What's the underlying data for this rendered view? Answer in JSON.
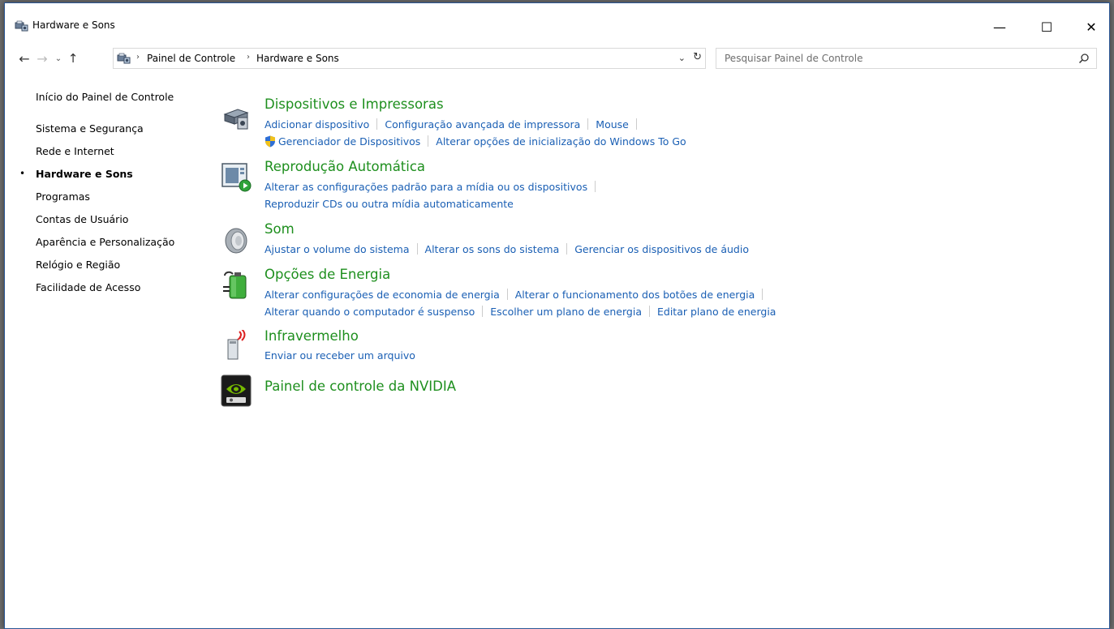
{
  "window": {
    "title": "Hardware e Sons",
    "controls": {
      "minimize": "—",
      "maximize": "☐",
      "close": "✕"
    }
  },
  "address_bar": {
    "breadcrumbs": [
      "Painel de Controle",
      "Hardware e Sons"
    ],
    "search_placeholder": "Pesquisar Painel de Controle"
  },
  "sidebar": {
    "home": "Início do Painel de Controle",
    "items": [
      {
        "label": "Sistema e Segurança",
        "active": false
      },
      {
        "label": "Rede e Internet",
        "active": false
      },
      {
        "label": "Hardware e Sons",
        "active": true
      },
      {
        "label": "Programas",
        "active": false
      },
      {
        "label": "Contas de Usuário",
        "active": false
      },
      {
        "label": "Aparência e Personalização",
        "active": false
      },
      {
        "label": "Relógio e Região",
        "active": false
      },
      {
        "label": "Facilidade de Acesso",
        "active": false
      }
    ]
  },
  "sections": [
    {
      "title": "Dispositivos e Impressoras",
      "icon": "devices-printers-icon",
      "rows": [
        [
          "Adicionar dispositivo",
          "Configuração avançada de impressora",
          "Mouse"
        ],
        [
          "Gerenciador de Dispositivos",
          "Alterar opções de inicialização do Windows To Go"
        ]
      ]
    },
    {
      "title": "Reprodução Automática",
      "icon": "autoplay-icon",
      "rows": [
        [
          "Alterar as configurações padrão para a mídia ou os dispositivos"
        ],
        [
          "Reproduzir CDs ou outra mídia automaticamente"
        ]
      ]
    },
    {
      "title": "Som",
      "icon": "speaker-icon",
      "rows": [
        [
          "Ajustar o volume do sistema",
          "Alterar os sons do sistema",
          "Gerenciar os dispositivos de áudio"
        ]
      ]
    },
    {
      "title": "Opções de Energia",
      "icon": "battery-power-icon",
      "rows": [
        [
          "Alterar configurações de economia de energia",
          "Alterar o funcionamento dos botões de energia"
        ],
        [
          "Alterar quando o computador é suspenso",
          "Escolher um plano de energia",
          "Editar plano de energia"
        ]
      ]
    },
    {
      "title": "Infravermelho",
      "icon": "infrared-icon",
      "rows": [
        [
          "Enviar ou receber um arquivo"
        ]
      ]
    },
    {
      "title": "Painel de controle da NVIDIA",
      "icon": "nvidia-icon",
      "rows": []
    }
  ],
  "colors": {
    "section_title": "#1e8f1e",
    "link": "#1a5fb4",
    "window_border": "#2b5797"
  }
}
